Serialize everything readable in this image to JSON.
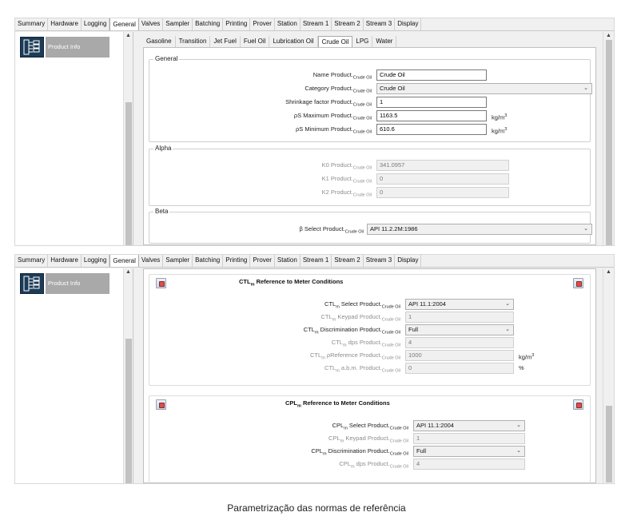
{
  "top_tabs": [
    "Summary",
    "Hardware",
    "Logging",
    "General",
    "Valves",
    "Sampler",
    "Batching",
    "Printing",
    "Prover",
    "Station",
    "Stream 1",
    "Stream 2",
    "Stream 3",
    "Display"
  ],
  "top_tab_active": "General",
  "nav": {
    "label": "Product Info",
    "icon": "product-info-icon"
  },
  "sub_tabs": [
    "Gasoline",
    "Transition",
    "Jet Fuel",
    "Fuel Oil",
    "Lubrication Oil",
    "Crude Oil",
    "LPG",
    "Water"
  ],
  "sub_tab_active": "Crude Oil",
  "product_sub": "Crude Oil",
  "panel1": {
    "general": {
      "title": "General",
      "name_label": "Name Product.",
      "name_value": "Crude Oil",
      "category_label": "Category Product.",
      "category_value": "Crude Oil",
      "shrinkage_label": "Shrinkage factor Product.",
      "shrinkage_value": "1",
      "max_label": "ρS Maximum Product.",
      "max_value": "1163.5",
      "min_label": "ρS Minimum Product.",
      "min_value": "610.6",
      "unit_base": "kg/m",
      "unit_sup": "3"
    },
    "alpha": {
      "title": "Alpha",
      "k0_label": "K0 Product.",
      "k0_value": "341.0957",
      "k1_label": "K1 Product.",
      "k1_value": "0",
      "k2_label": "K2 Product.",
      "k2_value": "0"
    },
    "beta": {
      "title": "Beta",
      "select_label": "β Select Product.",
      "select_value": "API 11.2.2M:1986"
    }
  },
  "panel2": {
    "ctl": {
      "title_pre": "CTL",
      "title_sub": "m",
      "title_post": " Reference to Meter Conditions",
      "select_label": "Select Product.",
      "select_value": "API 11.1:2004",
      "keypad_label": "Keypad Product.",
      "keypad_value": "1",
      "disc_label": "Discrimination Product.",
      "disc_value": "Full",
      "dps_label": "dps Product.",
      "dps_value": "4",
      "pref_label": "ρReference Product.",
      "pref_value": "1000",
      "pref_unit_base": "kg/m",
      "pref_unit_sup": "3",
      "abm_label": "a.b.m. Product.",
      "abm_value": "0",
      "abm_unit": "%"
    },
    "cpl": {
      "title_pre": "CPL",
      "title_sub": "m",
      "title_post": " Reference to Meter Conditions",
      "select_label": "Select Product.",
      "select_value": "API 11.1:2004",
      "keypad_label": "Keypad Product.",
      "keypad_value": "1",
      "disc_label": "Discrimination Product.",
      "disc_value": "Full",
      "dps_label": "dps Product.",
      "dps_value": "4"
    }
  },
  "caption": "Parametrização das normas de referência"
}
